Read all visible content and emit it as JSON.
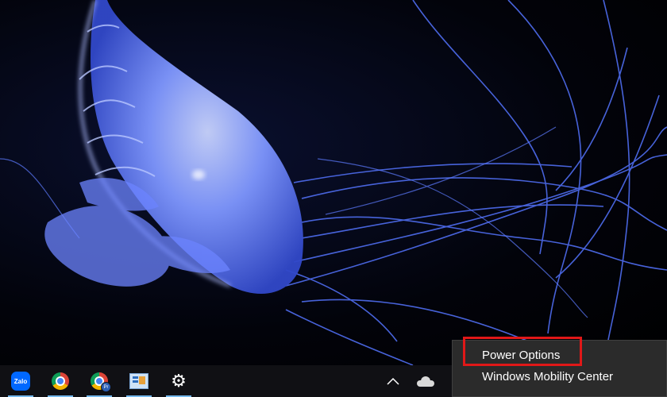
{
  "taskbar": {
    "items": [
      {
        "name": "zalo",
        "label": "Zalo"
      },
      {
        "name": "chrome",
        "label": ""
      },
      {
        "name": "chrome-profile",
        "label": "",
        "badge": "Pr"
      },
      {
        "name": "control-panel",
        "label": ""
      },
      {
        "name": "settings",
        "label": ""
      }
    ],
    "tray": {
      "chevron_icon": "chevron-up-icon",
      "cloud_icon": "onedrive-cloud-icon"
    }
  },
  "context_menu": {
    "items": [
      {
        "label": "Power Options"
      },
      {
        "label": "Windows Mobility Center"
      }
    ]
  },
  "colors": {
    "taskbar": "#101014",
    "menu_bg": "#2b2b2b",
    "highlight_border": "#e01818",
    "jellyfish": "#6f8cff"
  }
}
